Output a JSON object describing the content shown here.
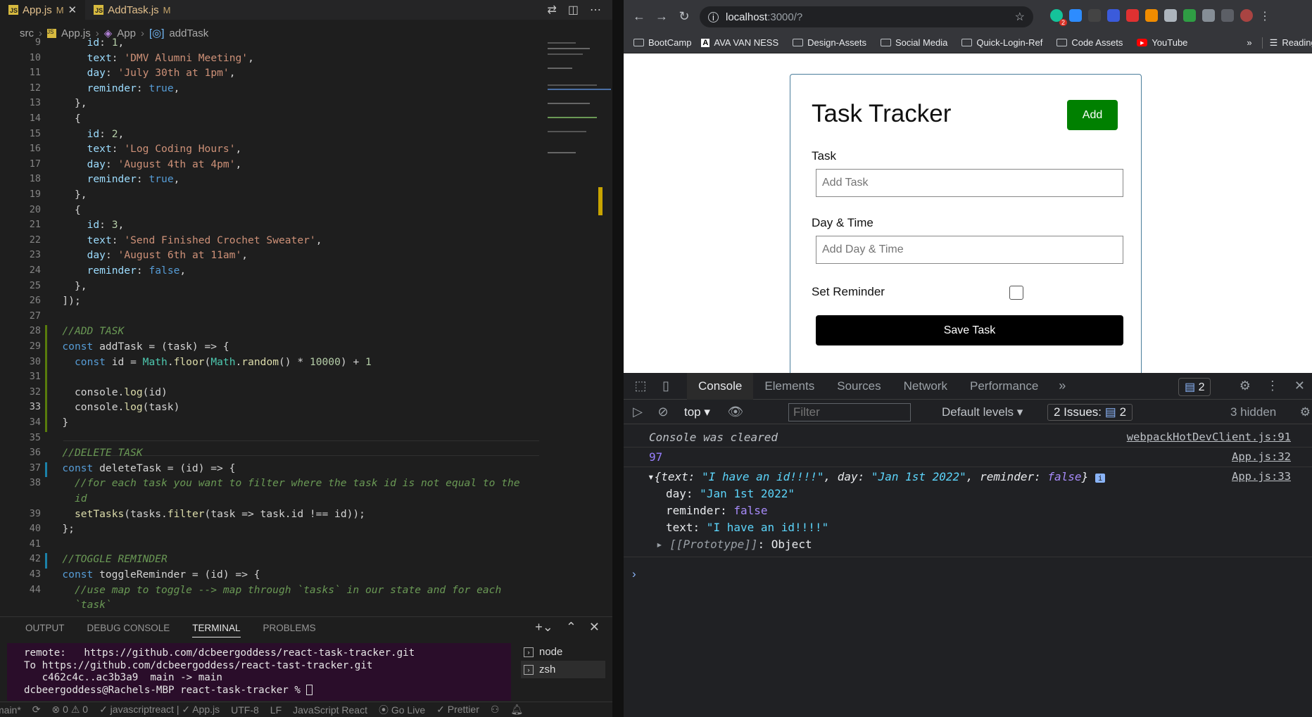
{
  "editor": {
    "tabs": [
      {
        "name": "App.js",
        "badge": "M"
      },
      {
        "name": "AddTask.js",
        "badge": "M"
      }
    ],
    "breadcrumb": [
      "src",
      "App.js",
      "App",
      "addTask"
    ],
    "lines": [
      {
        "n": "9",
        "t": "id: 1,"
      },
      {
        "n": "10",
        "t": "text: 'DMV Alumni Meeting',"
      },
      {
        "n": "11",
        "t": "day: 'July 30th at 1pm',"
      },
      {
        "n": "12",
        "t": "reminder: true,"
      },
      {
        "n": "13",
        "t": "},"
      },
      {
        "n": "14",
        "t": "{"
      },
      {
        "n": "15",
        "t": "id: 2,"
      },
      {
        "n": "16",
        "t": "text: 'Log Coding Hours',"
      },
      {
        "n": "17",
        "t": "day: 'August 4th at 4pm',"
      },
      {
        "n": "18",
        "t": "reminder: true,"
      },
      {
        "n": "19",
        "t": "},"
      },
      {
        "n": "20",
        "t": "{"
      },
      {
        "n": "21",
        "t": "id: 3,"
      },
      {
        "n": "22",
        "t": "text: 'Send Finished Crochet Sweater',"
      },
      {
        "n": "23",
        "t": "day: 'August 6th at 11am',"
      },
      {
        "n": "24",
        "t": "reminder: false,"
      },
      {
        "n": "25",
        "t": "},"
      },
      {
        "n": "26",
        "t": "]);"
      },
      {
        "n": "27",
        "t": ""
      },
      {
        "n": "28",
        "t": "//ADD TASK"
      },
      {
        "n": "29",
        "t": "const addTask = (task) => {"
      },
      {
        "n": "30",
        "t": "const id = Math.floor(Math.random() * 10000) + 1"
      },
      {
        "n": "31",
        "t": ""
      },
      {
        "n": "32",
        "t": "console.log(id)"
      },
      {
        "n": "33",
        "t": "console.log(task)"
      },
      {
        "n": "34",
        "t": "}"
      },
      {
        "n": "35",
        "t": ""
      },
      {
        "n": "36",
        "t": "//DELETE TASK"
      },
      {
        "n": "37",
        "t": "const deleteTask = (id) => {"
      },
      {
        "n": "38",
        "t": "//for each task you want to filter where the task id is not equal to the"
      },
      {
        "n": "",
        "t": "id"
      },
      {
        "n": "39",
        "t": "setTasks(tasks.filter(task => task.id !== id));"
      },
      {
        "n": "40",
        "t": "};"
      },
      {
        "n": "41",
        "t": ""
      },
      {
        "n": "42",
        "t": "//TOGGLE REMINDER"
      },
      {
        "n": "43",
        "t": "const toggleReminder = (id) => {"
      },
      {
        "n": "44",
        "t": "//use map to toggle --> map through `tasks` in our state and for each"
      },
      {
        "n": "",
        "t": "`task`"
      }
    ],
    "panel_tabs": [
      "OUTPUT",
      "DEBUG CONSOLE",
      "TERMINAL",
      "PROBLEMS"
    ],
    "terminal": [
      "remote:   https://github.com/dcbeergoddess/react-task-tracker.git",
      "To https://github.com/dcbeergoddess/react-tast-tracker.git",
      "   c462c4c..ac3b3a9  main -> main",
      "dcbeergoddess@Rachels-MBP react-task-tracker % "
    ],
    "shells": [
      "node",
      "zsh"
    ],
    "status": [
      "main*",
      "⊗ 0 ⚠ 0",
      "✓ javascriptreact | ✓ App.js",
      "UTF-8",
      "LF",
      "JavaScript React",
      "Go Live",
      "✓ Prettier"
    ]
  },
  "browser": {
    "url_host": "localhost",
    "url_path": ":3000/?",
    "extension_badge": "2",
    "bookmarks": [
      "BootCamp",
      "AVA VAN NESS",
      "Design-Assets",
      "Social Media",
      "Quick-Login-Ref",
      "Code Assets",
      "YouTube"
    ],
    "more": "»",
    "reading_list": "Reading List",
    "app": {
      "title": "Task Tracker",
      "add_button": "Add",
      "task_label": "Task",
      "task_placeholder": "Add Task",
      "day_label": "Day & Time",
      "day_placeholder": "Add Day & Time",
      "reminder_label": "Set Reminder",
      "save_button": "Save Task"
    },
    "devtools": {
      "tabs": [
        "Console",
        "Elements",
        "Sources",
        "Network",
        "Performance"
      ],
      "message_count": "2",
      "context": "top",
      "filter_placeholder": "Filter",
      "levels": "Default levels",
      "issues_label": "2 Issues:",
      "issues_count": "2",
      "hidden": "3 hidden",
      "console": {
        "cleared": "Console was cleared",
        "cleared_src": "webpackHotDevClient.js:91",
        "id_value": "97",
        "id_src": "App.js:32",
        "obj_src": "App.js:33",
        "obj_text": "I have an id!!!!",
        "obj_day": "Jan 1st 2022",
        "obj_reminder": "false",
        "prototype": "Object"
      }
    }
  }
}
